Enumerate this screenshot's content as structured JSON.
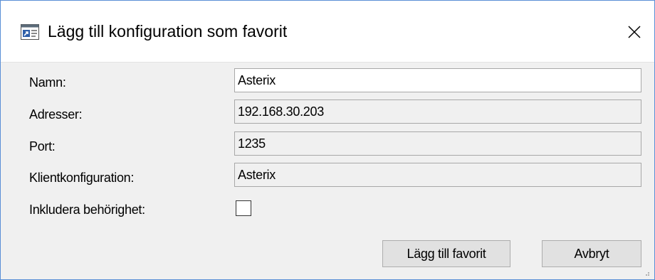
{
  "window": {
    "title": "Lägg till konfiguration som favorit",
    "icon": "app-window-icon",
    "close_icon": "close-icon"
  },
  "form": {
    "name_label": "Namn:",
    "name_value": "Asterix",
    "addresses_label": "Adresser:",
    "addresses_value": "192.168.30.203",
    "port_label": "Port:",
    "port_value": "1235",
    "client_config_label": "Klientkonfiguration:",
    "client_config_value": "Asterix",
    "include_permission_label": "Inkludera behörighet:",
    "include_permission_checked": false
  },
  "buttons": {
    "add_favorite": "Lägg till favorit",
    "cancel": "Avbryt"
  },
  "colors": {
    "window_border": "#5a8fd6",
    "dialog_bg": "#f0f0f0",
    "button_bg": "#e1e1e1"
  }
}
